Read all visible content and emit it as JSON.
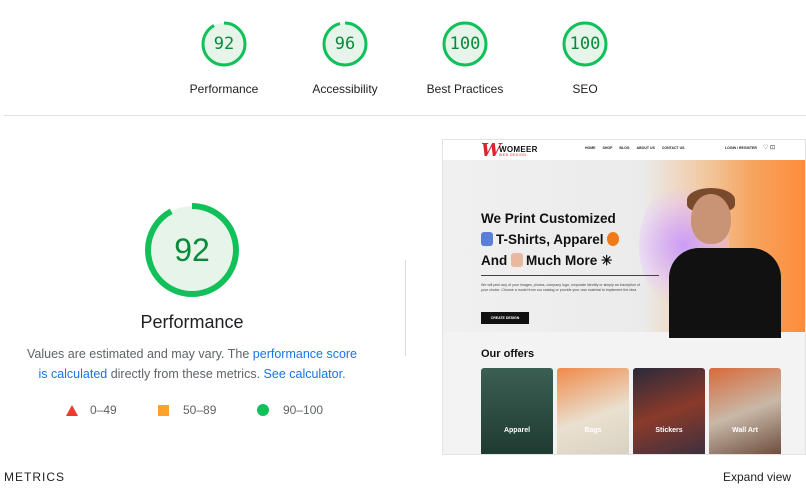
{
  "top_scores": [
    {
      "label": "Performance",
      "score": "92",
      "fraction": 0.92
    },
    {
      "label": "Accessibility",
      "score": "96",
      "fraction": 0.96
    },
    {
      "label": "Best Practices",
      "score": "100",
      "fraction": 1.0
    },
    {
      "label": "SEO",
      "score": "100",
      "fraction": 1.0
    }
  ],
  "main": {
    "score": "92",
    "fraction": 0.92,
    "title": "Performance",
    "desc_prefix": "Values are estimated and may vary. The ",
    "desc_link1": "performance score is calculated",
    "desc_middle": " directly from these metrics. ",
    "desc_link2": "See calculator",
    "desc_suffix": "."
  },
  "legend": {
    "fail": "0–49",
    "average": "50–89",
    "pass": "90–100"
  },
  "preview": {
    "logo_mark": "W",
    "logo_name": "WOMEER",
    "logo_tagline": "WEB DESIGN",
    "menu": [
      "HOME",
      "SHOP",
      "BLOG",
      "ABOUT US",
      "CONTACT US"
    ],
    "login": "LOGIN / REGISTER",
    "hero_line1": "We Print Customized",
    "hero_line2": "T-Shirts, Apparel",
    "hero_line3a": "And",
    "hero_line3b": "Much More",
    "hero_paragraph": "We will print any of your images, photos, company logo, corporate identity or simply an inscription of your choice. Choose a model from our catalog or provide your own material to implement the idea",
    "hero_button": "CREATE DESIGN",
    "offers_title": "Our offers",
    "offers": [
      "Apparel",
      "Bags",
      "Stickers",
      "Wall Art"
    ]
  },
  "colors": {
    "pass": "#0a8a3a",
    "pass_ring": "#12c05a",
    "pass_fill": "#e6f4ea",
    "link": "#1a73e8"
  },
  "footer": {
    "metrics_label": "METRICS",
    "expand_label": "Expand view"
  }
}
